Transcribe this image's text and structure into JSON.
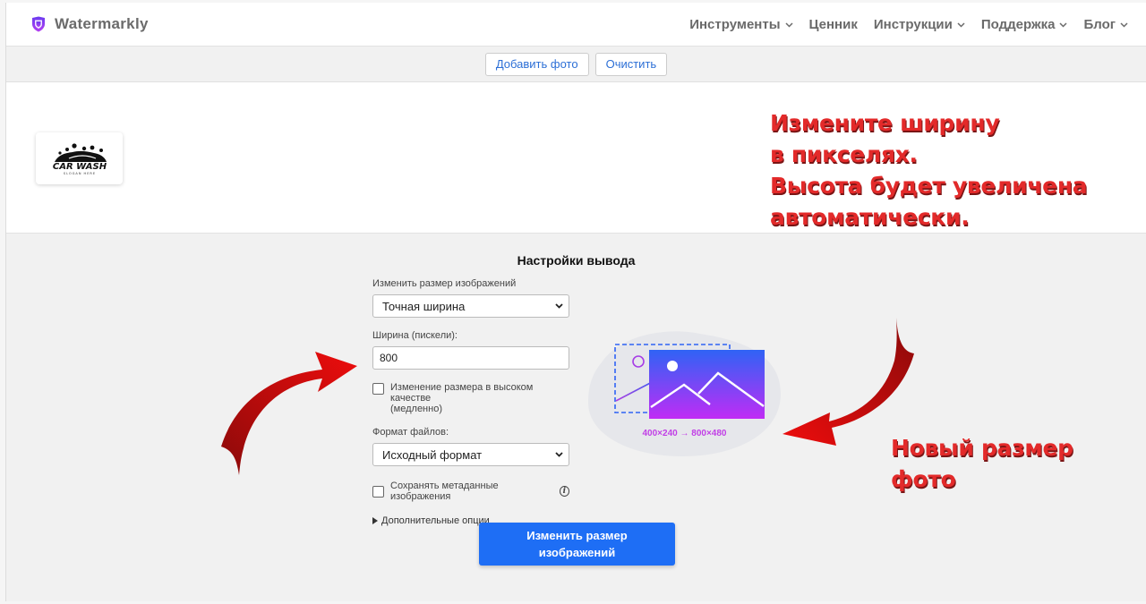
{
  "header": {
    "brand": "Watermarkly",
    "brand_color": "#7c3aed",
    "nav": [
      {
        "label": "Инструменты",
        "has_dropdown": true
      },
      {
        "label": "Ценник",
        "has_dropdown": false
      },
      {
        "label": "Инструкции",
        "has_dropdown": true
      },
      {
        "label": "Поддержка",
        "has_dropdown": true
      },
      {
        "label": "Блог",
        "has_dropdown": true
      }
    ]
  },
  "toolbar": {
    "add_photo_label": "Добавить фото",
    "clear_label": "Очистить"
  },
  "image_area": {
    "thumbnail": {
      "title": "CAR WASH",
      "subtitle": "SLOGAN HERE"
    }
  },
  "annotations": {
    "top_lines": [
      "Измените ширину",
      "в пикселях.",
      "Высота будет увеличена",
      "автоматически."
    ],
    "bottom_lines": [
      "Новый размер",
      "фото"
    ],
    "color": "#e32a2a"
  },
  "settings": {
    "title": "Настройки вывода",
    "resize_label": "Изменить размер изображений",
    "resize_value": "Точная ширина",
    "width_label": "Ширина (пискели):",
    "width_value": "800",
    "hq_label_line1": "Изменение размера в высоком качестве",
    "hq_label_line2": "(медленно)",
    "hq_checked": false,
    "format_label": "Формат файлов:",
    "format_value": "Исходный формат",
    "metadata_label": "Сохранять метаданные изображения",
    "metadata_checked": false,
    "more_options_label": "Дополнительные опции",
    "submit_label_line1": "Изменить размер",
    "submit_label_line2": "изображений",
    "size_change_text": "400×240 → 800×480",
    "primary_color": "#1e6ef5"
  }
}
